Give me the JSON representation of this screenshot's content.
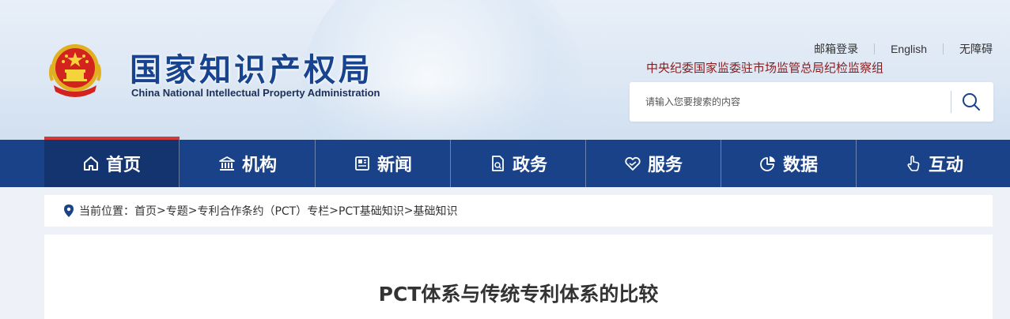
{
  "header": {
    "site_name_cn": "国家知识产权局",
    "site_name_en": "China National Intellectual Property Administration",
    "top_links": [
      "邮箱登录",
      "English",
      "无障碍"
    ],
    "supervision_text": "中央纪委国家监委驻市场监管总局纪检监察组",
    "search_placeholder": "请输入您要搜索的内容"
  },
  "nav": {
    "items": [
      {
        "label": "首页",
        "icon": "home-icon",
        "active": true
      },
      {
        "label": "机构",
        "icon": "institution-icon",
        "active": false
      },
      {
        "label": "新闻",
        "icon": "newspaper-icon",
        "active": false
      },
      {
        "label": "政务",
        "icon": "document-icon",
        "active": false
      },
      {
        "label": "服务",
        "icon": "service-heart-icon",
        "active": false
      },
      {
        "label": "数据",
        "icon": "pie-chart-icon",
        "active": false
      },
      {
        "label": "互动",
        "icon": "hand-pointer-icon",
        "active": false
      }
    ]
  },
  "breadcrumb": {
    "prefix": "当前位置：",
    "items": [
      "首页",
      "专题",
      "专利合作条约（PCT）专栏",
      "PCT基础知识",
      "基础知识"
    ],
    "separator": ">"
  },
  "article": {
    "title": "PCT体系与传统专利体系的比较"
  },
  "colors": {
    "nav_bg": "#1a4288",
    "nav_active_bg": "#13346f",
    "nav_active_top": "#d23a3a",
    "logo_blue": "#17438f",
    "supervision_red": "#8b1b1b"
  }
}
